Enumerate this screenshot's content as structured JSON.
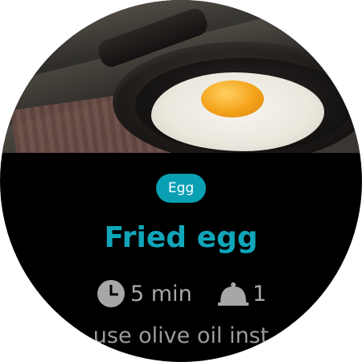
{
  "recipe": {
    "tag": "Egg",
    "title": "Fried egg",
    "time": "5 min",
    "servings": "1",
    "description_visible": "use olive oil inst"
  },
  "icons": {
    "time": "clock-icon",
    "servings": "cloche-icon"
  },
  "colors": {
    "accent": "#0aa0b4",
    "title": "#10a6ba",
    "meta_text": "#a7a7a7",
    "background": "#000000"
  }
}
